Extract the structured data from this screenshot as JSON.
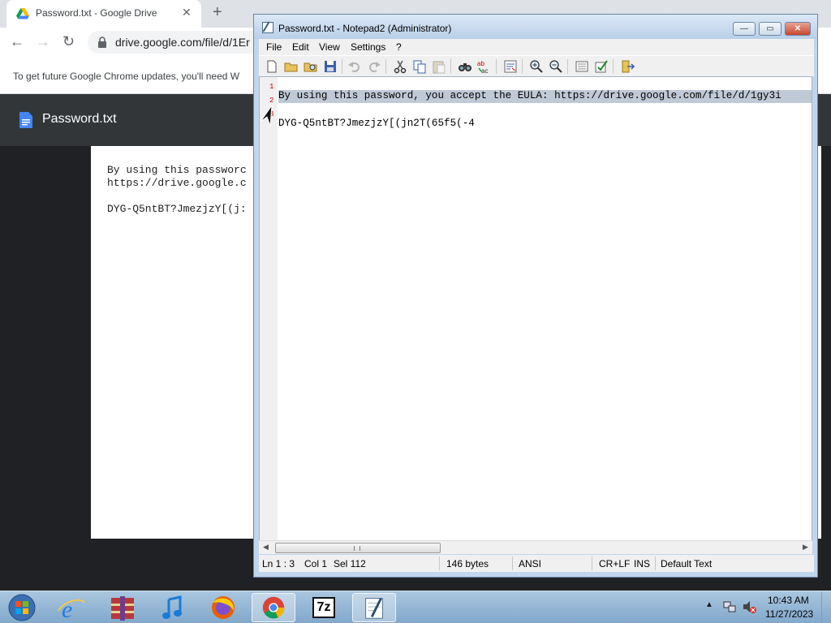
{
  "browser": {
    "tab_title": "Password.txt - Google Drive",
    "tab_close": "✕",
    "new_tab": "+",
    "back": "←",
    "forward": "→",
    "reload": "↻",
    "url": "drive.google.com/file/d/1Er",
    "infobar_text": "To get future Google Chrome updates, you'll need W",
    "file_name": "Password.txt",
    "doc_lines": [
      "By using this passworc",
      "https://drive.google.c",
      "DYG-Q5ntBT?JmezjzY[(j:"
    ]
  },
  "notepad": {
    "title": "Password.txt - Notepad2 (Administrator)",
    "window_buttons": {
      "minimize": "—",
      "maximize": "▭",
      "close": "✕"
    },
    "menu": [
      "File",
      "Edit",
      "View",
      "Settings",
      "?"
    ],
    "lines": [
      {
        "num": "1",
        "text": "By using this password, you accept the EULA: https://drive.google.com/file/d/1gy3i"
      },
      {
        "num": "2",
        "text": ""
      },
      {
        "num": "3",
        "text": "DYG-Q5ntBT?JmezjzY[(jn2T(65f5(-4"
      }
    ],
    "status": {
      "position": "Ln 1 : 3",
      "col": "Col 1",
      "sel": "Sel 112",
      "size": "146 bytes",
      "encoding": "ANSI",
      "eol": "CR+LF",
      "mode": "INS",
      "scheme": "Default Text"
    },
    "scroll_left": "◀",
    "scroll_right": "▶"
  },
  "taskbar": {
    "apps": [
      "internet-explorer",
      "archive",
      "itunes",
      "firefox",
      "chrome",
      "7zip",
      "notepad2"
    ],
    "app_7zip_label": "7z",
    "tray_up": "▲",
    "time": "10:43 AM",
    "date": "11/27/2023"
  },
  "colors": {
    "selection": "#c0c9d6",
    "line_numbers": "#c00000",
    "chrome_dark": "#202124",
    "window_frame": "#c1d6ee"
  }
}
